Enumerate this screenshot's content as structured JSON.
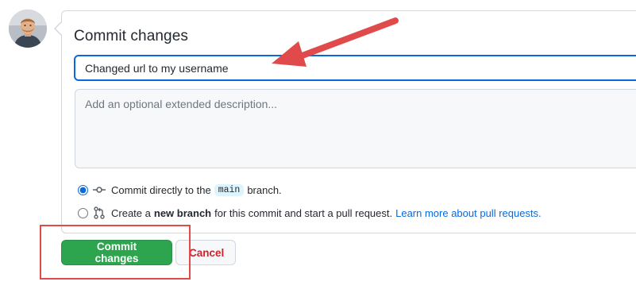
{
  "commit_form": {
    "title": "Commit changes",
    "summary_value": "Changed url to my username",
    "description_placeholder": "Add an optional extended description...",
    "options": [
      {
        "selected": true,
        "icon": "git-commit-icon",
        "text_before": "Commit directly to the",
        "branch": "main",
        "text_after": "branch."
      },
      {
        "selected": false,
        "icon": "git-pull-request-icon",
        "text_before": "Create a",
        "bold": "new branch",
        "text_after": "for this commit and start a pull request.",
        "link": "Learn more about pull requests."
      }
    ],
    "commit_button_label": "Commit changes",
    "cancel_button_label": "Cancel"
  },
  "annotations": {
    "arrow_color": "#e04a4a",
    "highlight_color": "#e04a4a"
  },
  "colors": {
    "accent_blue": "#0969da",
    "commit_green": "#2da44e",
    "cancel_red": "#cf222e",
    "border": "#d0d7de"
  }
}
